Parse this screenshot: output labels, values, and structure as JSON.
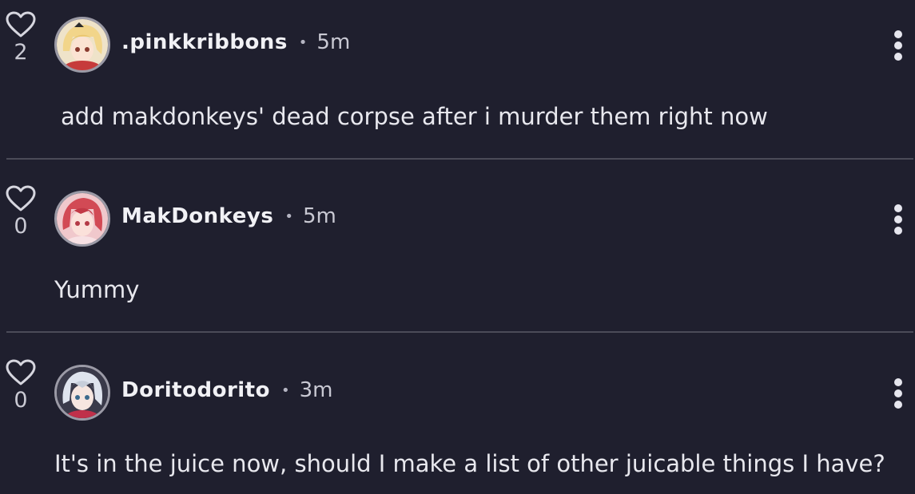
{
  "comments": [
    {
      "likes": "2",
      "username": ".pinkkribbons",
      "time": "5m",
      "text": "add makdonkeys' dead corpse after i murder them right now",
      "avatar_icon": "anime-avatar-blonde-icon",
      "avatar_colors": {
        "bg": "#efe3c9",
        "hair": "#f2d58a",
        "accent": "#c63b3b"
      }
    },
    {
      "likes": "0",
      "username": "MakDonkeys",
      "time": "5m",
      "text": "Yummy",
      "avatar_icon": "anime-avatar-redhair-icon",
      "avatar_colors": {
        "bg": "#f0c8cc",
        "hair": "#d24a55",
        "accent": "#f7e1e4"
      }
    },
    {
      "likes": "0",
      "username": "Doritodorito",
      "time": "3m",
      "text": "It's in the juice now, should I make a list of other juicable things I have?",
      "avatar_icon": "anime-avatar-silverhair-icon",
      "avatar_colors": {
        "bg": "#3a3a4a",
        "hair": "#dfe4ee",
        "accent": "#c0304a"
      }
    }
  ],
  "separator": "•",
  "theme": {
    "background": "#1f1f2e",
    "divider": "#4b4b58",
    "text": "#e8e8ee"
  }
}
